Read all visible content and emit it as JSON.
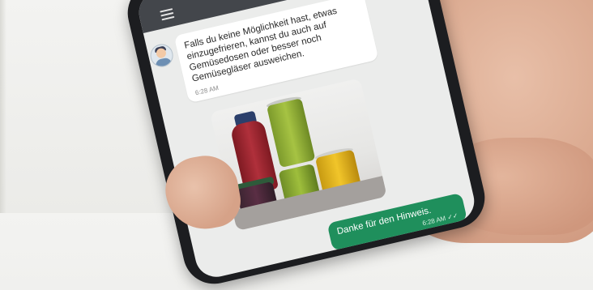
{
  "chat": {
    "incoming_message": "Falls du keine Möglichkeit hast, etwas einzugefrieren, kannst du auch auf Gemüsedosen oder besser noch Gemüsegläser ausweichen.",
    "incoming_time": "6:28 AM",
    "outgoing_message": "Danke für den Hinweis.",
    "outgoing_time": "6:28 AM"
  },
  "colors": {
    "appbar": "#43464b",
    "outgoing_bubble": "#1f8f5c",
    "incoming_bubble": "#ffffff"
  },
  "icons": {
    "menu": "hamburger-menu-icon",
    "avatar": "bot-avatar",
    "read_receipt": "double-check-icon"
  }
}
